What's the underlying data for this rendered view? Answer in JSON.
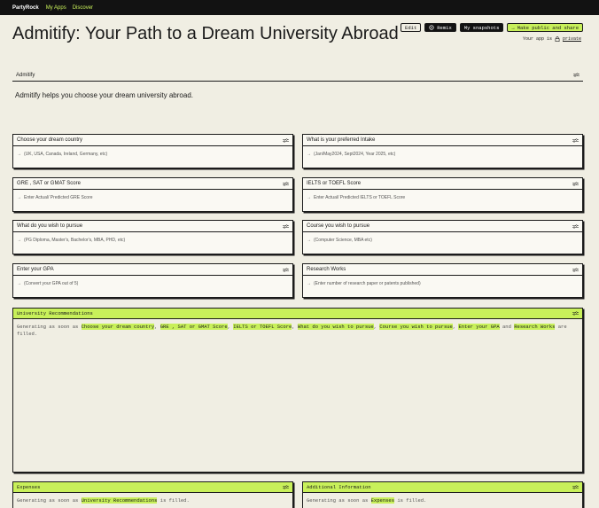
{
  "topbar": {
    "brand": "PartyRock",
    "nav": [
      "My Apps",
      "Discover"
    ]
  },
  "page": {
    "title": "Admitify: Your Path to a Dream University Abroad"
  },
  "actions": {
    "edit": "Edit",
    "remix": "Remix",
    "snapshots": "My snapshots",
    "share": "Make public and share"
  },
  "privacy": {
    "prefix": "Your app is",
    "status": "private"
  },
  "section": {
    "label": "Admitify",
    "description": "Admitify helps you choose your dream university abroad."
  },
  "inputs": [
    {
      "label": "Choose your dream country",
      "placeholder": "(UK, USA, Canada, Ireland, Germany, etc)"
    },
    {
      "label": "What is your preferred Intake",
      "placeholder": "(Jan/May2024, Sept2024, Year 2025, etc)"
    },
    {
      "label": "GRE , SAT or GMAT Score",
      "placeholder": "Enter Actual/ Predicted GRE Score"
    },
    {
      "label": "IELTS or TOEFL Score",
      "placeholder": "Enter Actual/ Predicted IELTS or TOEFL Score"
    },
    {
      "label": "What do you wish to pursue",
      "placeholder": "(PG Diploma, Master's, Bachelor's, MBA, PHD, etc)"
    },
    {
      "label": "Course you wish to pursue",
      "placeholder": "(Computer Science, MBA etc)"
    },
    {
      "label": "Enter your GPA",
      "placeholder": "(Convert your GPA out of 5)"
    },
    {
      "label": "Research Works",
      "placeholder": "(Enter number of research paper or patents published)"
    }
  ],
  "outputs": {
    "recommendations": {
      "label": "University Recommendations",
      "prefix": "Generating as soon as",
      "deps": [
        "Choose your dream country",
        "GRE , SAT or GMAT Score",
        "IELTS or TOEFL Score",
        "What do you wish to pursue",
        "Course you wish to pursue",
        "Enter your GPA",
        "Research Works"
      ],
      "and": "and",
      "suffix": "are filled."
    },
    "expenses": {
      "label": "Expenses",
      "prefix": "Generating as soon as",
      "dep": "University Recommendations",
      "suffix": "is filled."
    },
    "additional": {
      "label": "Additional Information",
      "prefix": "Generating as soon as",
      "dep": "Expenses",
      "suffix": "is filled."
    }
  },
  "colors": {
    "accent": "#c8f05a",
    "background": "#f0eee3",
    "topbar": "#121212"
  }
}
